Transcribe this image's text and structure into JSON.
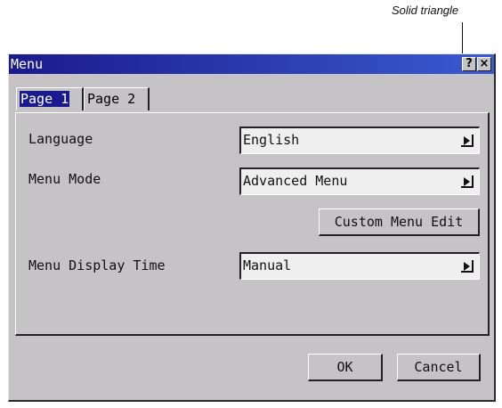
{
  "annotation": {
    "label": "Solid triangle"
  },
  "window": {
    "title": "Menu",
    "help_label": "?",
    "close_label": "×"
  },
  "tabs": [
    {
      "label": "Page 1",
      "selected": true
    },
    {
      "label": "Page 2",
      "selected": false
    }
  ],
  "settings": {
    "language_label": "Language",
    "language_value": "English",
    "menu_mode_label": "Menu Mode",
    "menu_mode_value": "Advanced Menu",
    "custom_menu_edit_label": "Custom Menu Edit",
    "menu_display_time_label": "Menu Display Time",
    "menu_display_time_value": "Manual"
  },
  "buttons": {
    "ok_label": "OK",
    "cancel_label": "Cancel"
  },
  "icons": {
    "dropdown": "solid-triangle-right-icon"
  }
}
